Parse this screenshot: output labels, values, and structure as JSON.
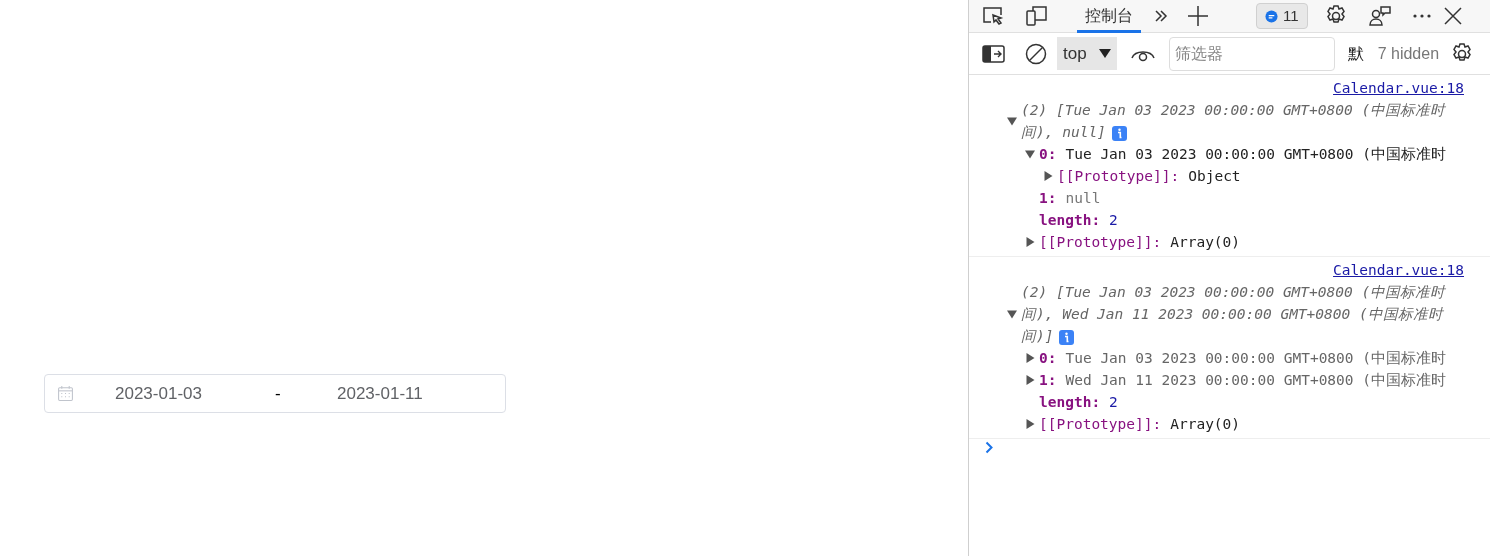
{
  "date_range": {
    "start": "2023-01-03",
    "separator": "-",
    "end": "2023-01-11"
  },
  "devtools": {
    "tabs": [
      {
        "label": "控制台",
        "selected": true
      }
    ],
    "issue_count": "11",
    "context": "top",
    "filter_placeholder": "筛选器",
    "levels_label": "默",
    "hidden_count": "7 hidden"
  },
  "console": [
    {
      "source": "Calendar.vue:18",
      "summary": "(2) [Tue Jan 03 2023 00:00:00 GMT+0800 (中国标准时间), null]",
      "expanded": true,
      "children": [
        {
          "key": "0:",
          "value": "Tue Jan 03 2023 00:00:00 GMT+0800 (中国标准时",
          "kind": "date",
          "expanded": true,
          "children": [
            {
              "key": "[[Prototype]]:",
              "value": "Object",
              "kind": "object",
              "expanded": false
            }
          ]
        },
        {
          "key": "1:",
          "value": "null",
          "kind": "null"
        },
        {
          "key": "length:",
          "value": "2",
          "kind": "number"
        },
        {
          "key": "[[Prototype]]:",
          "value": "Array(0)",
          "kind": "object",
          "expanded": false
        }
      ]
    },
    {
      "source": "Calendar.vue:18",
      "summary": "(2) [Tue Jan 03 2023 00:00:00 GMT+0800 (中国标准时间), Wed Jan 11 2023 00:00:00 GMT+0800 (中国标准时间)]",
      "expanded": true,
      "children": [
        {
          "key": "0:",
          "value": "Tue Jan 03 2023 00:00:00 GMT+0800 (中国标准时",
          "kind": "date",
          "expanded": false
        },
        {
          "key": "1:",
          "value": "Wed Jan 11 2023 00:00:00 GMT+0800 (中国标准时",
          "kind": "date",
          "expanded": false
        },
        {
          "key": "length:",
          "value": "2",
          "kind": "number"
        },
        {
          "key": "[[Prototype]]:",
          "value": "Array(0)",
          "kind": "object",
          "expanded": false
        }
      ]
    }
  ]
}
